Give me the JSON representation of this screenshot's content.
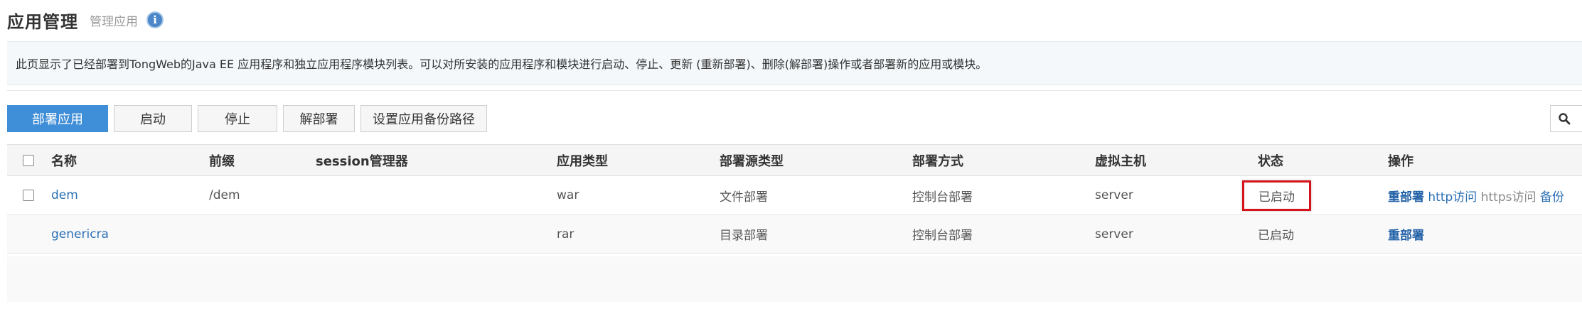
{
  "header": {
    "title": "应用管理",
    "subtitle": "管理应用",
    "info_icon": "info-icon"
  },
  "description": "此页显示了已经部署到TongWeb的Java EE 应用程序和独立应用程序模块列表。可以对所安装的应用程序和模块进行启动、停止、更新 (重新部署)、删除(解部署)操作或者部署新的应用或模块。",
  "toolbar": {
    "deploy_label": "部署应用",
    "start_label": "启动",
    "stop_label": "停止",
    "undeploy_label": "解部署",
    "backup_path_label": "设置应用备份路径",
    "search_icon": "search-icon"
  },
  "table": {
    "headers": [
      "名称",
      "前缀",
      "session管理器",
      "应用类型",
      "部署源类型",
      "部署方式",
      "虚拟主机",
      "状态",
      "操作"
    ],
    "rows": [
      {
        "name": "dem",
        "prefix": "/dem",
        "session_manager": "",
        "app_type": "war",
        "source_type": "文件部署",
        "deploy_mode": "控制台部署",
        "virtual_host": "server",
        "status": "已启动",
        "actions": {
          "redeploy": "重部署",
          "http": "http访问",
          "https": "https访问",
          "backup": "备份"
        }
      },
      {
        "name": "genericra",
        "prefix": "",
        "session_manager": "",
        "app_type": "rar",
        "source_type": "目录部署",
        "deploy_mode": "控制台部署",
        "virtual_host": "server",
        "status": "已启动",
        "actions": {
          "redeploy": "重部署"
        }
      }
    ]
  },
  "colors": {
    "primary": "#3f8ed8",
    "highlight": "#d4141a",
    "link": "#2a6fb5"
  }
}
